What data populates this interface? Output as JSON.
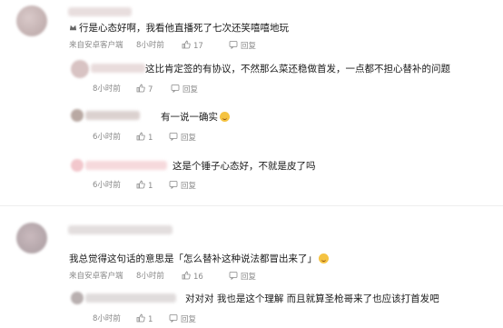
{
  "comments": [
    {
      "text": "行是心态好啊，我看他直播死了七次还笑嘻嘻地玩",
      "source": "来自安卓客户端",
      "time": "8小时前",
      "likes": "17",
      "reply_label": "回复"
    },
    {
      "text": "这比肯定签的有协议，不然那么菜还稳做首发，一点都不担心替补的问题",
      "time": "8小时前",
      "likes": "7",
      "reply_label": "回复"
    },
    {
      "text": "有一说一确实",
      "time": "6小时前",
      "likes": "1",
      "reply_label": "回复"
    },
    {
      "text": "这是个锤子心态好，不就是皮了吗",
      "time": "6小时前",
      "likes": "1",
      "reply_label": "回复"
    },
    {
      "text": "我总觉得这句话的意思是「怎么替补这种说法都冒出来了」",
      "source": "来自安卓客户端",
      "time": "8小时前",
      "likes": "16",
      "reply_label": "回复"
    },
    {
      "text": "对对对 我也是这个理解 而且就算圣枪哥来了也应该打首发吧",
      "time": "8小时前",
      "likes": "1",
      "reply_label": "回复"
    }
  ],
  "colors": {
    "meta": "#8a8a8a",
    "text": "#1a1a1a",
    "divider": "#eeeeee"
  }
}
